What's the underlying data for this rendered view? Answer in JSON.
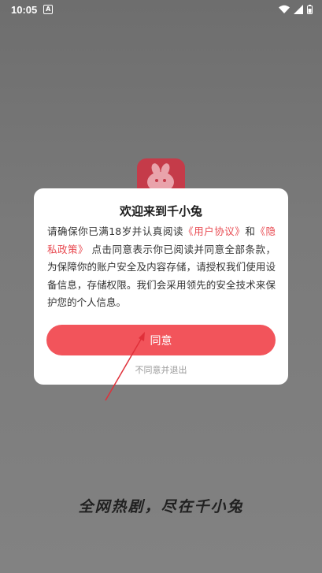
{
  "status_bar": {
    "time": "10:05",
    "notification_icon": "a-icon",
    "icons": [
      "wifi-icon",
      "signal-icon",
      "battery-icon"
    ]
  },
  "background": {
    "slogan": "全网热剧，尽在千小兔",
    "logo_color": "#c53b49"
  },
  "dialog": {
    "title": "欢迎来到千小兔",
    "body_prefix": "请确保你已满18岁并认真阅读",
    "user_agreement_link": "《用户协议》",
    "and_text": "和",
    "privacy_policy_link": "《隐私政策》",
    "body_suffix": " 点击同意表示你已阅读并同意全部条款，为保障你的账户安全及内容存储，请授权我们使用设备信息，存储权限。我们会采用领先的安全技术来保护您的个人信息。",
    "agree_label": "同意",
    "disagree_label": "不同意并退出"
  },
  "colors": {
    "accent": "#f2545b",
    "link": "#e84a51",
    "annotation": "#e0303a"
  }
}
